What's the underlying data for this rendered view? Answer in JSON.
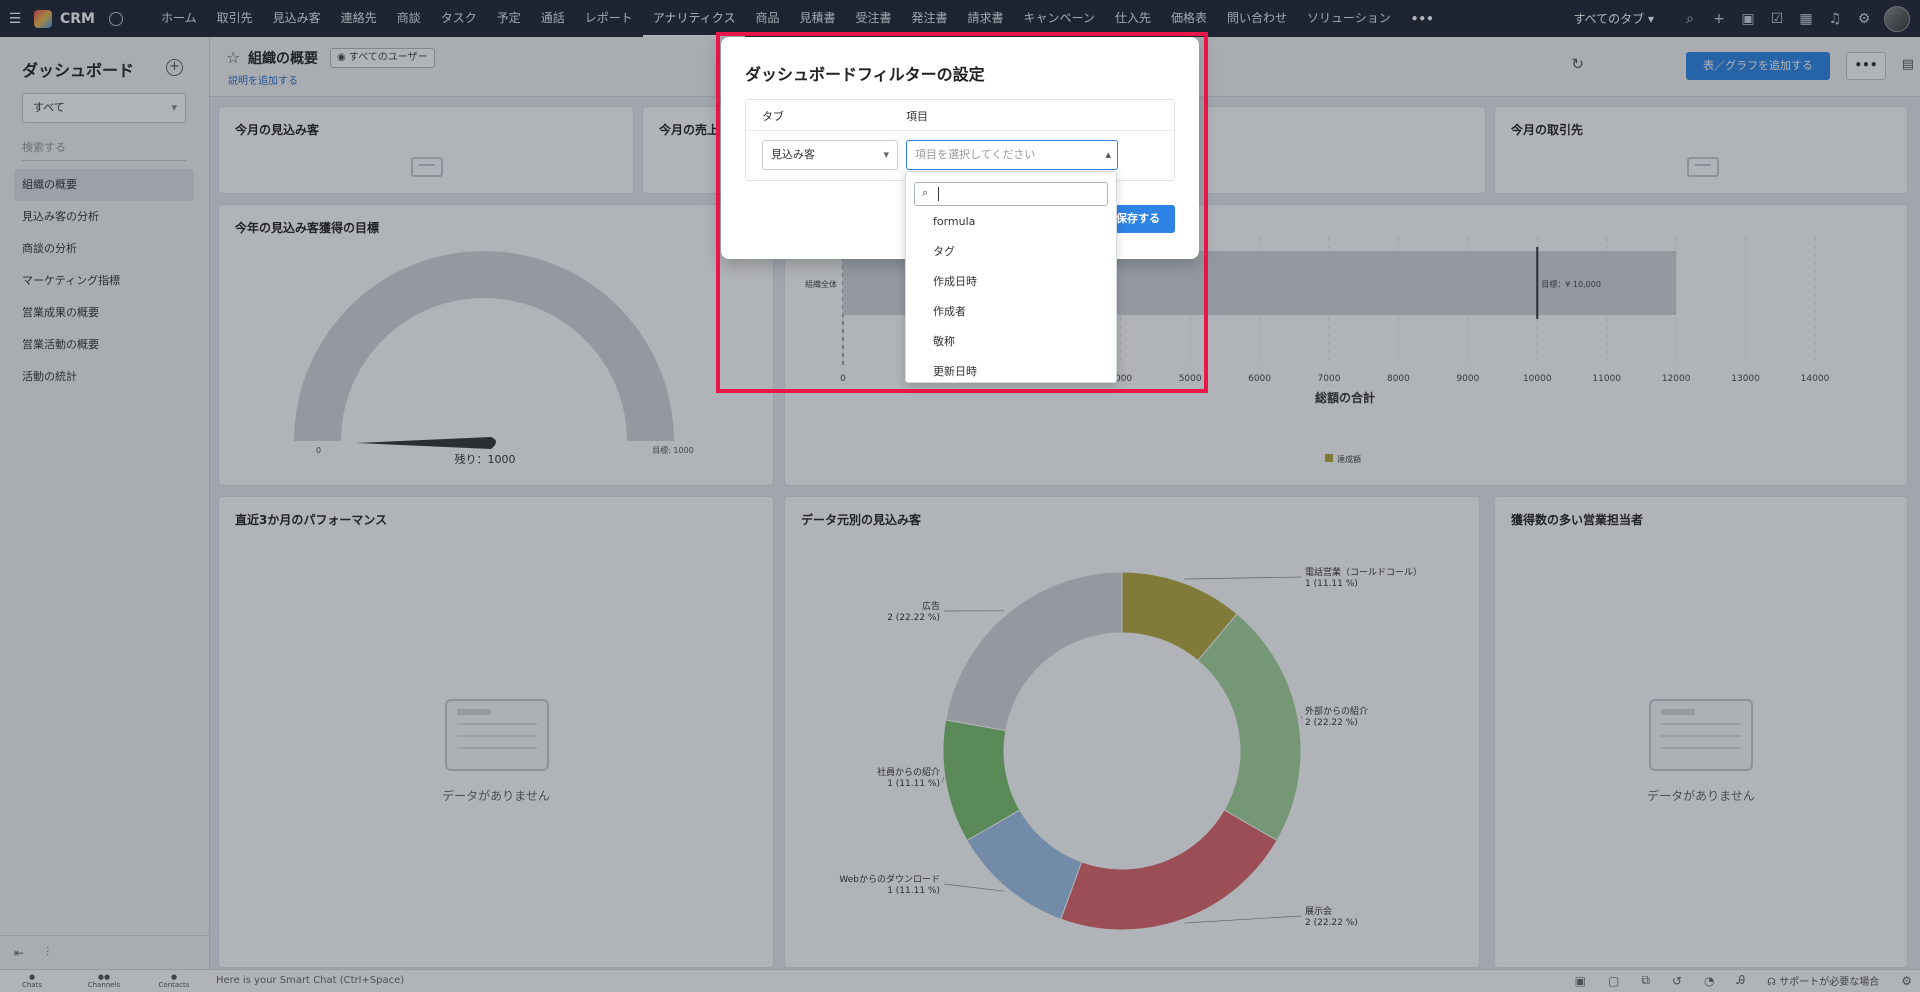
{
  "app": {
    "name": "CRM"
  },
  "nav": {
    "items": [
      "ホーム",
      "取引先",
      "見込み客",
      "連絡先",
      "商談",
      "タスク",
      "予定",
      "通話",
      "レポート",
      "アナリティクス",
      "商品",
      "見積書",
      "受注書",
      "発注書",
      "請求書",
      "キャンペーン",
      "仕入先",
      "価格表",
      "問い合わせ",
      "ソリューション"
    ],
    "active": "アナリティクス",
    "more": "•••",
    "all_tabs": "すべてのタブ ▾"
  },
  "sidebar": {
    "title": "ダッシュボード",
    "select_value": "すべて",
    "search_placeholder": "検索する",
    "items": [
      "組織の概要",
      "見込み客の分析",
      "商談の分析",
      "マーケティング指標",
      "営業成果の概要",
      "営業活動の概要",
      "活動の統計"
    ],
    "active_index": 0
  },
  "header": {
    "title": "組織の概要",
    "users_chip": "すべてのユーザー",
    "add_description": "説明を追加する",
    "add_graph_button": "表／グラフを追加する",
    "more_button": "•••"
  },
  "cards": {
    "leads_this_month": "今月の見込み客",
    "sales_this_month": "今月の売上",
    "accounts_this_month": "今月の取引先",
    "lead_goal": "今年の見込み客獲得の目標",
    "gauge": {
      "min_label": "0",
      "remaining": "残り：1000",
      "target_label": "目標: 1000",
      "value": 0,
      "target": 1000
    },
    "performance": "直近3か月のパフォーマンス",
    "leads_by_source": "データ元別の見込み客",
    "top_reps": "獲得数の多い営業担当者",
    "no_data": "データがありません"
  },
  "chart_data": [
    {
      "type": "bar",
      "categories": [
        "組織全体"
      ],
      "series": [
        {
          "name": "達成額",
          "values": [
            12000
          ]
        }
      ],
      "target_label": "目標：¥ 10,000",
      "target": 10000,
      "xlabel": "総額の合計",
      "xticks": [
        "0",
        "4000",
        "5000",
        "6000",
        "7000",
        "8000",
        "9000",
        "10000",
        "11000",
        "12000",
        "13000",
        "14000"
      ]
    },
    {
      "type": "pie",
      "labels": [
        "電話営業（コールドコール）",
        "外部からの紹介",
        "展示会",
        "Webからのダウンロード",
        "社員からの紹介",
        "広告"
      ],
      "values": [
        1,
        2,
        2,
        1,
        1,
        2
      ],
      "value_labels": [
        "1 (11.11 %)",
        "2 (22.22 %)",
        "2 (22.22 %)",
        "1 (11.11 %)",
        "1 (11.11 %)",
        "2 (22.22 %)"
      ],
      "colors": [
        "#b5a93c",
        "#a6d49c",
        "#e0646c",
        "#9ec2e9",
        "#7bc16e",
        "#d5d8de"
      ]
    }
  ],
  "modal": {
    "title": "ダッシュボードフィルターの設定",
    "col_tab": "タブ",
    "col_item": "項目",
    "tab_value": "見込み客",
    "item_placeholder": "項目を選択してください",
    "save_button": "保存する"
  },
  "dropdown": {
    "options": [
      "formula",
      "タグ",
      "作成日時",
      "作成者",
      "敬称",
      "更新日時"
    ]
  },
  "bottombar": {
    "tabs": [
      "Chats",
      "Channels",
      "Contacts"
    ],
    "chat_placeholder": "Here is your Smart Chat (Ctrl+Space)",
    "support": "サポートが必要な場合"
  }
}
